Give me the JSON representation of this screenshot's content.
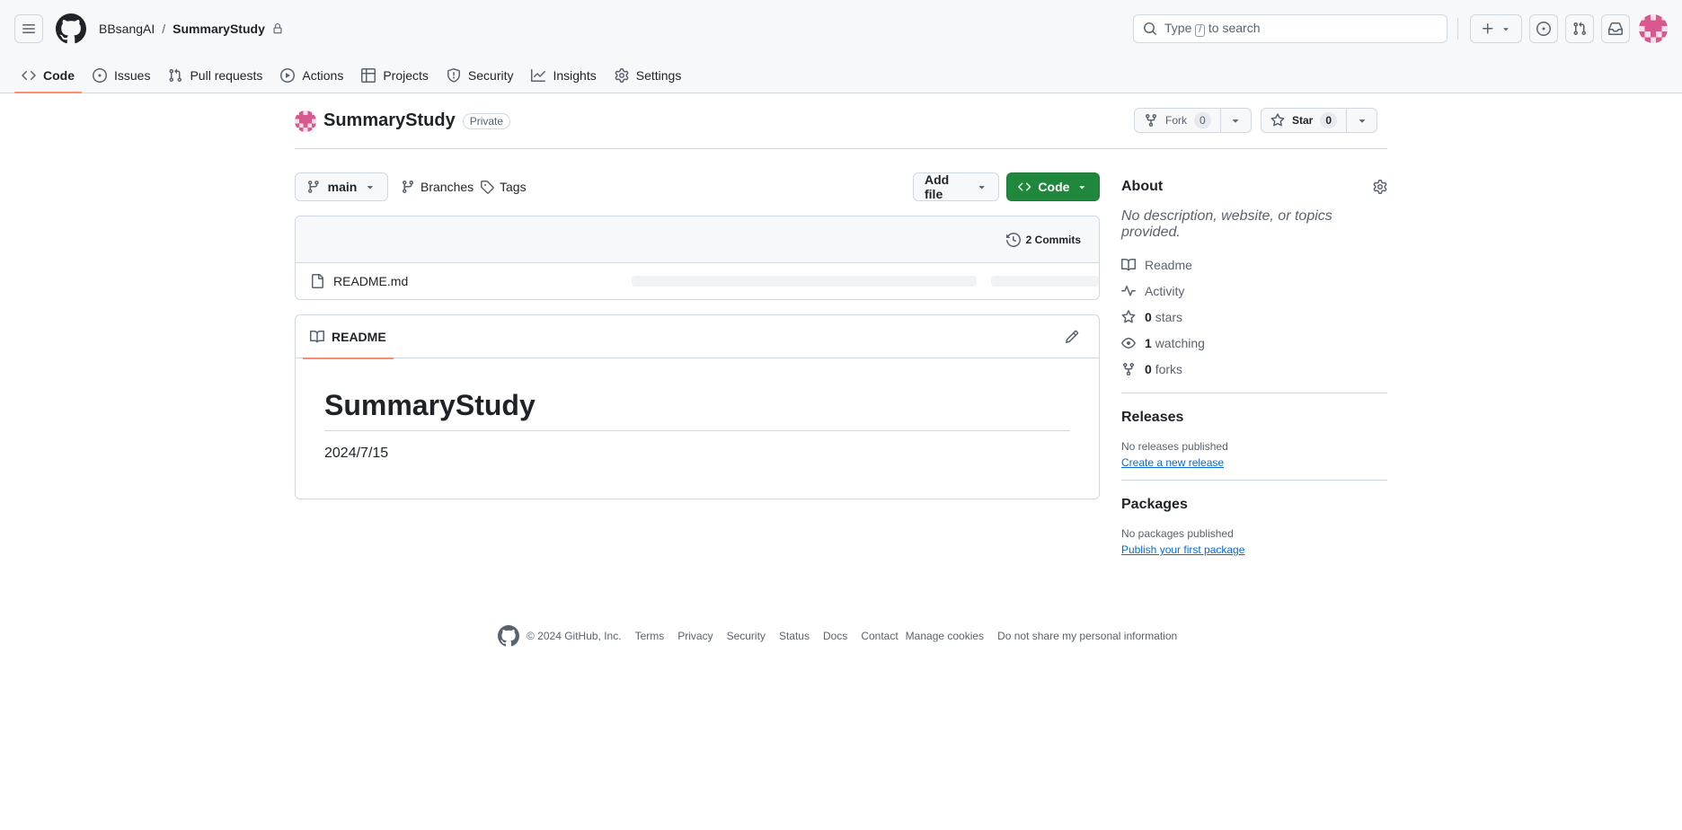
{
  "header": {
    "owner": "BBsangAI",
    "separator": "/",
    "repo": "SummaryStudy",
    "search": {
      "prefix": "Type",
      "key": "/",
      "suffix": "to search"
    }
  },
  "tabs": [
    {
      "label": "Code",
      "icon": "code-icon",
      "active": true
    },
    {
      "label": "Issues",
      "icon": "issue-opened-icon"
    },
    {
      "label": "Pull requests",
      "icon": "git-pull-request-icon"
    },
    {
      "label": "Actions",
      "icon": "play-icon"
    },
    {
      "label": "Projects",
      "icon": "table-icon"
    },
    {
      "label": "Security",
      "icon": "shield-icon"
    },
    {
      "label": "Insights",
      "icon": "graph-icon"
    },
    {
      "label": "Settings",
      "icon": "gear-icon"
    }
  ],
  "repo": {
    "name": "SummaryStudy",
    "visibility": "Private",
    "fork_label": "Fork",
    "fork_count": "0",
    "star_label": "Star",
    "star_count": "0"
  },
  "branch": {
    "name": "main",
    "branches_label": "Branches",
    "tags_label": "Tags",
    "add_file_label": "Add file",
    "code_label": "Code"
  },
  "files": {
    "commits_label": "2 Commits",
    "items": [
      {
        "name": "README.md",
        "icon": "file-icon"
      }
    ]
  },
  "readme": {
    "tab_label": "README",
    "heading": "SummaryStudy",
    "body": "2024/7/15"
  },
  "about": {
    "title": "About",
    "description": "No description, website, or topics provided.",
    "items": [
      {
        "icon": "book-icon",
        "count": "",
        "label": "Readme"
      },
      {
        "icon": "pulse-icon",
        "count": "",
        "label": "Activity"
      },
      {
        "icon": "star-icon",
        "count": "0",
        "label": "stars"
      },
      {
        "icon": "eye-icon",
        "count": "1",
        "label": "watching"
      },
      {
        "icon": "repo-forked-icon",
        "count": "0",
        "label": "forks"
      }
    ]
  },
  "releases": {
    "title": "Releases",
    "empty": "No releases published",
    "link": "Create a new release"
  },
  "packages": {
    "title": "Packages",
    "empty": "No packages published",
    "link": "Publish your first package"
  },
  "footer": {
    "copyright": "© 2024 GitHub, Inc.",
    "links": [
      "Terms",
      "Privacy",
      "Security",
      "Status",
      "Docs",
      "Contact",
      "Manage cookies",
      "Do not share my personal information"
    ]
  },
  "colors": {
    "accent_tab": "#fd8c73",
    "code_button": "#1f883d",
    "link": "#0969da"
  }
}
